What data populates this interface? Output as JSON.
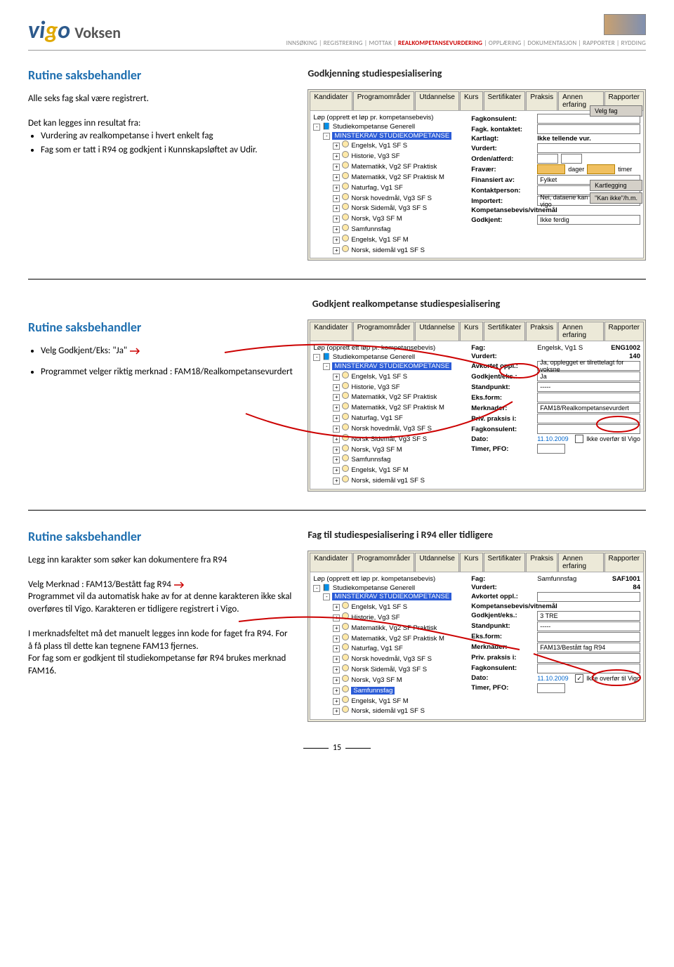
{
  "header": {
    "logo_prefix": "vi",
    "logo_g": "g",
    "logo_o": "o",
    "logo_suffix": "Voksen",
    "breadcrumb": [
      "INNSØKING",
      "REGISTRERING",
      "MOTTAK",
      "REALKOMPETANSEVURDERING",
      "OPPLÆRING",
      "DOKUMENTASJON",
      "RAPPORTER",
      "RYDDING"
    ],
    "breadcrumb_active_index": 3
  },
  "section1": {
    "routine": "Rutine saksbehandler",
    "sub": "Godkjenning studiespesialisering",
    "p1": "Alle seks fag skal være registrert.",
    "p2_lead": "Det kan legges inn resultat fra:",
    "bullets": [
      "Vurdering av realkompetanse i hvert enkelt fag",
      "Fag som er tatt i R94 og godkjent i Kunnskapsløftet av Udir."
    ],
    "shot": {
      "tabs": [
        "Kandidater",
        "Programområder",
        "Utdannelse",
        "Kurs",
        "Sertifikater",
        "Praksis",
        "Annen erfaring",
        "Rapporter"
      ],
      "tree_caption": "Løp (opprett et løp pr. kompetansebevis)",
      "tree_root": "Studiekompetanse Generell",
      "tree_selected": "MINSTEKRAV STUDIEKOMPETANSE",
      "tree_items": [
        "Engelsk, Vg1 SF S",
        "Historie, Vg3 SF",
        "Matematikk, Vg2 SF Praktisk",
        "Matematikk, Vg2 SF Praktisk M",
        "Naturfag, Vg1 SF",
        "Norsk hovedmål, Vg3 SF S",
        "Norsk Sidemål, Vg3 SF S",
        "Norsk, Vg3 SF M",
        "Samfunnsfag",
        "Engelsk, Vg1 SF M",
        "Norsk, sidemål vg1 SF S"
      ],
      "fields": {
        "fagkonsulent": "Fagkonsulent:",
        "fagk_kontaktet": "Fagk. kontaktet:",
        "kartlagt": "Kartlagt:",
        "kartlagt_val": "Ikke tellende vur.",
        "vurdert": "Vurdert:",
        "orden_atferd": "Orden/atferd:",
        "fravaer": "Fravær:",
        "dager": "dager",
        "timer": "timer",
        "finansiert": "Finansiert av:",
        "finansiert_val": "Fylket",
        "kontaktperson": "Kontaktperson:",
        "importert": "Importert:",
        "importert_val": "Nei, dataene kan eksporteres til vigo",
        "komp_vitn": "Kompetansebevis/vitnemål",
        "godkjent": "Godkjent:",
        "godkjent_val": "Ikke ferdig"
      },
      "btn_velg_fag": "Velg fag",
      "btn_kartlegging": "Kartlegging",
      "btn_kan_ikke": "\"Kan ikke\"/h.m."
    }
  },
  "section2": {
    "sub": "Godkjent realkompetanse studiespesialisering",
    "routine": "Rutine saksbehandler",
    "b1": "Velg Godkjent/Eks: \"Ja\"",
    "b2": "Programmet velger riktig merknad : FAM18/Realkompetansevurdert",
    "shot": {
      "tabs": [
        "Kandidater",
        "Programområder",
        "Utdannelse",
        "Kurs",
        "Sertifikater",
        "Praksis",
        "Annen erfaring",
        "Rapporter"
      ],
      "tree_caption": "Løp (opprett ett løp pr. kompetansebevis)",
      "tree_root": "Studiekompetanse Generell",
      "tree_sel": "MINSTEKRAV STUDIEKOMPETANSE",
      "tree_items": [
        "Engelsk, Vg1 SF S",
        "Historie, Vg3 SF",
        "Matematikk, Vg2 SF Praktisk",
        "Matematikk, Vg2 SF Praktisk M",
        "Naturfag, Vg1 SF",
        "Norsk hovedmål, Vg3 SF S",
        "Norsk Sidemål, Vg3 SF S",
        "Norsk, Vg3 SF M",
        "Samfunnsfag",
        "Engelsk, Vg1 SF M",
        "Norsk, sidemål vg1 SF S"
      ],
      "f": {
        "fag": "Fag:",
        "fag_val": "Engelsk, Vg1 S",
        "fag_code": "ENG1002",
        "vurdert": "Vurdert:",
        "vurdert_val": "140",
        "avkortet": "Avkortet oppl.:",
        "avkortet_val": "Ja, opplegget er tilrettelagt for voksne",
        "godkjent_eks": "Godkjent/eks.:",
        "godkjent_eks_val": "Ja",
        "standpunkt": "Standpunkt:",
        "standpunkt_val": "-----",
        "eksform": "Eks.form:",
        "merknader": "Merknader:",
        "merknader_val": "FAM18/Realkompetansevurdert",
        "priv_praksis": "Priv. praksis i:",
        "fagkonsulent": "Fagkonsulent:",
        "dato": "Dato:",
        "dato_val": "11.10.2009",
        "overfor": "Ikke overfør til Vigo",
        "timer_pfo": "Timer, PFO:"
      }
    }
  },
  "section3": {
    "routine": "Rutine saksbehandler",
    "sub": "Fag til studiespesialisering i R94 eller tidligere",
    "p1": "Legg inn karakter som søker kan dokumentere fra R94",
    "p2": "Velg Merknad : FAM13/Bestått fag  R94",
    "p3": "Programmet vil da automatisk hake av for at denne karakteren ikke skal overføres til Vigo. Karakteren er tidligere registrert i Vigo.",
    "p4": "I merknadsfeltet må det manuelt legges inn kode for faget fra R94. For å få plass til dette kan tegnene FAM13 fjernes.",
    "p5": "For fag som er godkjent til studiekompetanse før R94 brukes merknad FAM16.",
    "shot": {
      "tabs": [
        "Kandidater",
        "Programområder",
        "Utdannelse",
        "Kurs",
        "Sertifikater",
        "Praksis",
        "Annen erfaring",
        "Rapporter"
      ],
      "tree_caption": "Løp (opprett ett løp pr. kompetansebevis)",
      "tree_root": "Studiekompetanse Generell",
      "tree_sel": "MINSTEKRAV STUDIEKOMPETANSE",
      "tree_items": [
        "Engelsk, Vg1 SF S",
        "Historie, Vg3 SF",
        "Matematikk, Vg2 SF Praktisk",
        "Matematikk, Vg2 SF Praktisk M",
        "Naturfag, Vg1 SF",
        "Norsk hovedmål, Vg3 SF S",
        "Norsk Sidemål, Vg3 SF S",
        "Norsk, Vg3 SF M",
        "Samfunnsfag",
        "Engelsk, Vg1 SF M",
        "Norsk, sidemål vg1 SF S"
      ],
      "tree_highlight_index": 8,
      "f": {
        "fag": "Fag:",
        "fag_val": "Samfunnsfag",
        "fag_code": "SAF1001",
        "vurdert": "Vurdert:",
        "vurdert_val": "84",
        "avkortet": "Avkortet oppl.:",
        "komp_vitn": "Kompetansebevis/vitnemål",
        "godkjent_eks": "Godkjent/eks.:",
        "godkjent_eks_val": "3 TRE",
        "standpunkt": "Standpunkt:",
        "standpunkt_val": "-----",
        "eksform": "Eks.form:",
        "merknader": "Merknader:",
        "merknader_val": "FAM13/Bestått fag R94",
        "priv_praksis": "Priv. praksis i:",
        "fagkonsulent": "Fagkonsulent:",
        "dato": "Dato:",
        "dato_val": "11.10.2009",
        "overfor": "Ikke overfør til Vigo",
        "timer_pfo": "Timer, PFO:"
      }
    }
  },
  "page_number": "15"
}
